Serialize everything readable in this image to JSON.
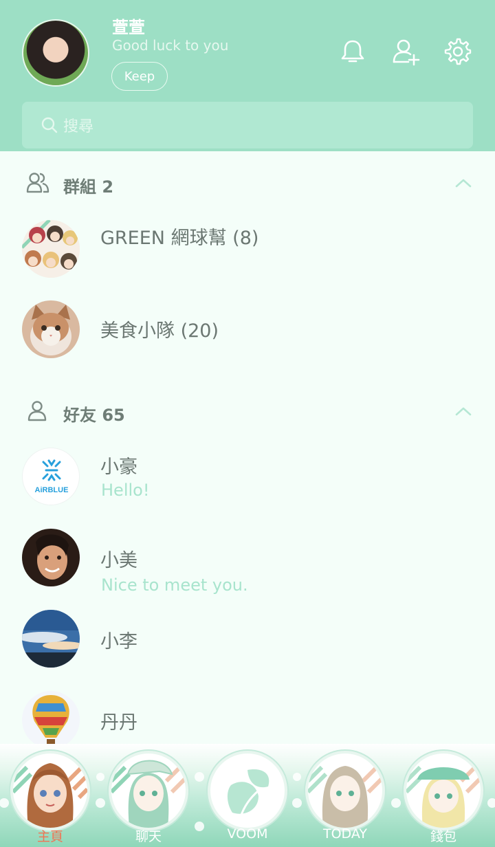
{
  "profile": {
    "name": "萱萱",
    "status": "Good luck to you",
    "keep_label": "Keep"
  },
  "header_icons": [
    "bell-icon",
    "add-friend-icon",
    "gear-icon"
  ],
  "search": {
    "placeholder": "搜尋"
  },
  "groups": {
    "title": "群組 2",
    "items": [
      {
        "name": "GREEN 網球幫 (8)"
      },
      {
        "name": "美食小隊 (20)"
      }
    ]
  },
  "friends": {
    "title": "好友 65",
    "items": [
      {
        "name": "小豪",
        "message": "Hello!",
        "avatar_text": "AiRBLUE"
      },
      {
        "name": "小美",
        "message": "Nice to meet you."
      },
      {
        "name": "小李"
      },
      {
        "name": "丹丹"
      }
    ]
  },
  "nav": [
    {
      "label": "主頁",
      "active": true
    },
    {
      "label": "聊天"
    },
    {
      "label": "VOOM"
    },
    {
      "label": "TODAY"
    },
    {
      "label": "錢包"
    }
  ],
  "colors": {
    "header": "#9ddfc5",
    "accent": "#a8e4cd",
    "active_tab": "#f07454",
    "text": "#6b7772"
  }
}
